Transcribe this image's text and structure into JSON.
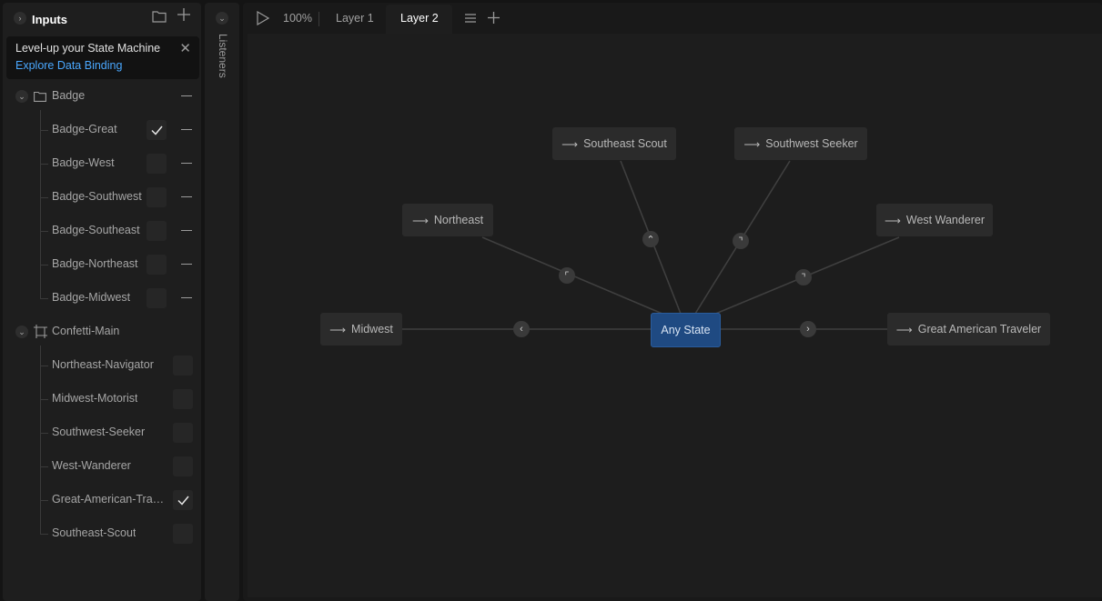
{
  "left_panel": {
    "title": "Inputs",
    "banner": {
      "line1": "Level-up your State Machine",
      "link": "Explore Data Binding"
    },
    "group1": {
      "label": "Badge",
      "items": [
        {
          "label": "Badge-Great",
          "checked": true
        },
        {
          "label": "Badge-West",
          "checked": false
        },
        {
          "label": "Badge-Southwest",
          "checked": false
        },
        {
          "label": "Badge-Southeast",
          "checked": false
        },
        {
          "label": "Badge-Northeast",
          "checked": false
        },
        {
          "label": "Badge-Midwest",
          "checked": false
        }
      ]
    },
    "group2": {
      "label": "Confetti-Main",
      "items": [
        {
          "label": "Northeast-Navigator",
          "checked": false
        },
        {
          "label": "Midwest-Motorist",
          "checked": false
        },
        {
          "label": "Southwest-Seeker",
          "checked": false
        },
        {
          "label": "West-Wanderer",
          "checked": false
        },
        {
          "label": "Great-American-Trave...",
          "checked": true
        },
        {
          "label": "Southeast-Scout",
          "checked": false
        }
      ]
    }
  },
  "listeners_label": "Listeners",
  "toolbar": {
    "zoom": "100%",
    "tabs": [
      "Layer 1",
      "Layer 2"
    ],
    "active_tab": "Layer 2"
  },
  "graph": {
    "center": "Any State",
    "nodes": [
      "Southeast Scout",
      "Southwest Seeker",
      "Northeast",
      "West Wanderer",
      "Midwest",
      "Great American Traveler"
    ]
  },
  "colors": {
    "accent": "#4aa8ff",
    "any_state": "#1f4a82"
  }
}
